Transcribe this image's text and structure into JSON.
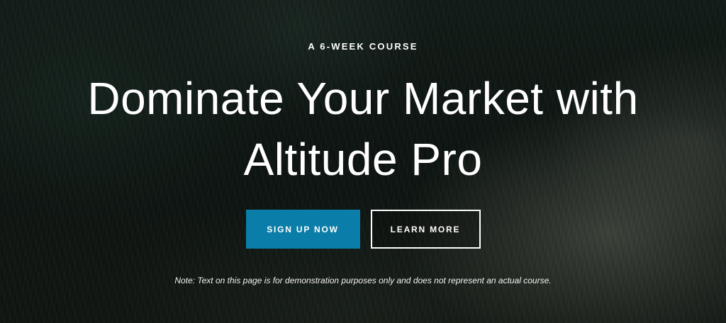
{
  "hero": {
    "eyebrow": "A 6-WEEK COURSE",
    "headline": "Dominate Your Market with Altitude Pro",
    "primary_button": "SIGN UP NOW",
    "secondary_button": "LEARN MORE",
    "note": "Note: Text on this page is for demonstration purposes only and does not represent an actual course."
  },
  "colors": {
    "primary_button_bg": "#0a7ea8",
    "text": "#ffffff"
  }
}
